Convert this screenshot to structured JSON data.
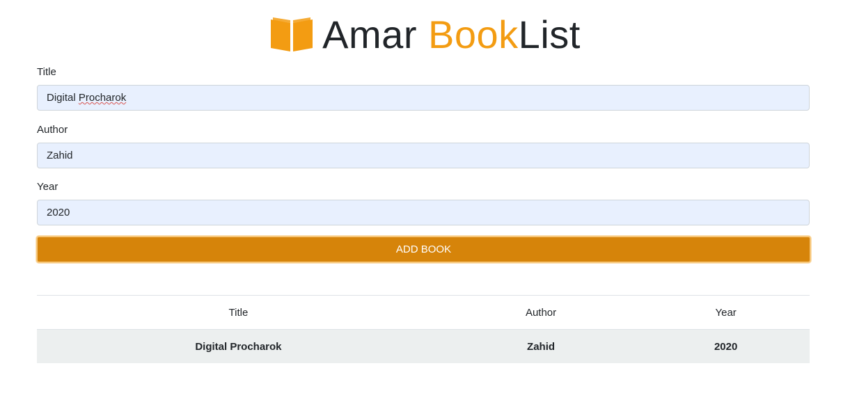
{
  "header": {
    "brand_part1": "Amar ",
    "brand_accent": "Book",
    "brand_part2": "List",
    "accent_color": "#f39c12",
    "icon": "book-open-icon"
  },
  "form": {
    "title_label": "Title",
    "title_value": "Digital Procharok",
    "title_value_word1": "Digital ",
    "title_value_word2": "Procharok",
    "author_label": "Author",
    "author_value": "Zahid",
    "year_label": "Year",
    "year_value": "2020",
    "submit_label": "ADD BOOK",
    "submit_color": "#d6840a"
  },
  "table": {
    "headers": [
      "Title",
      "Author",
      "Year"
    ],
    "rows": [
      [
        "Digital Procharok",
        "Zahid",
        "2020"
      ]
    ]
  }
}
